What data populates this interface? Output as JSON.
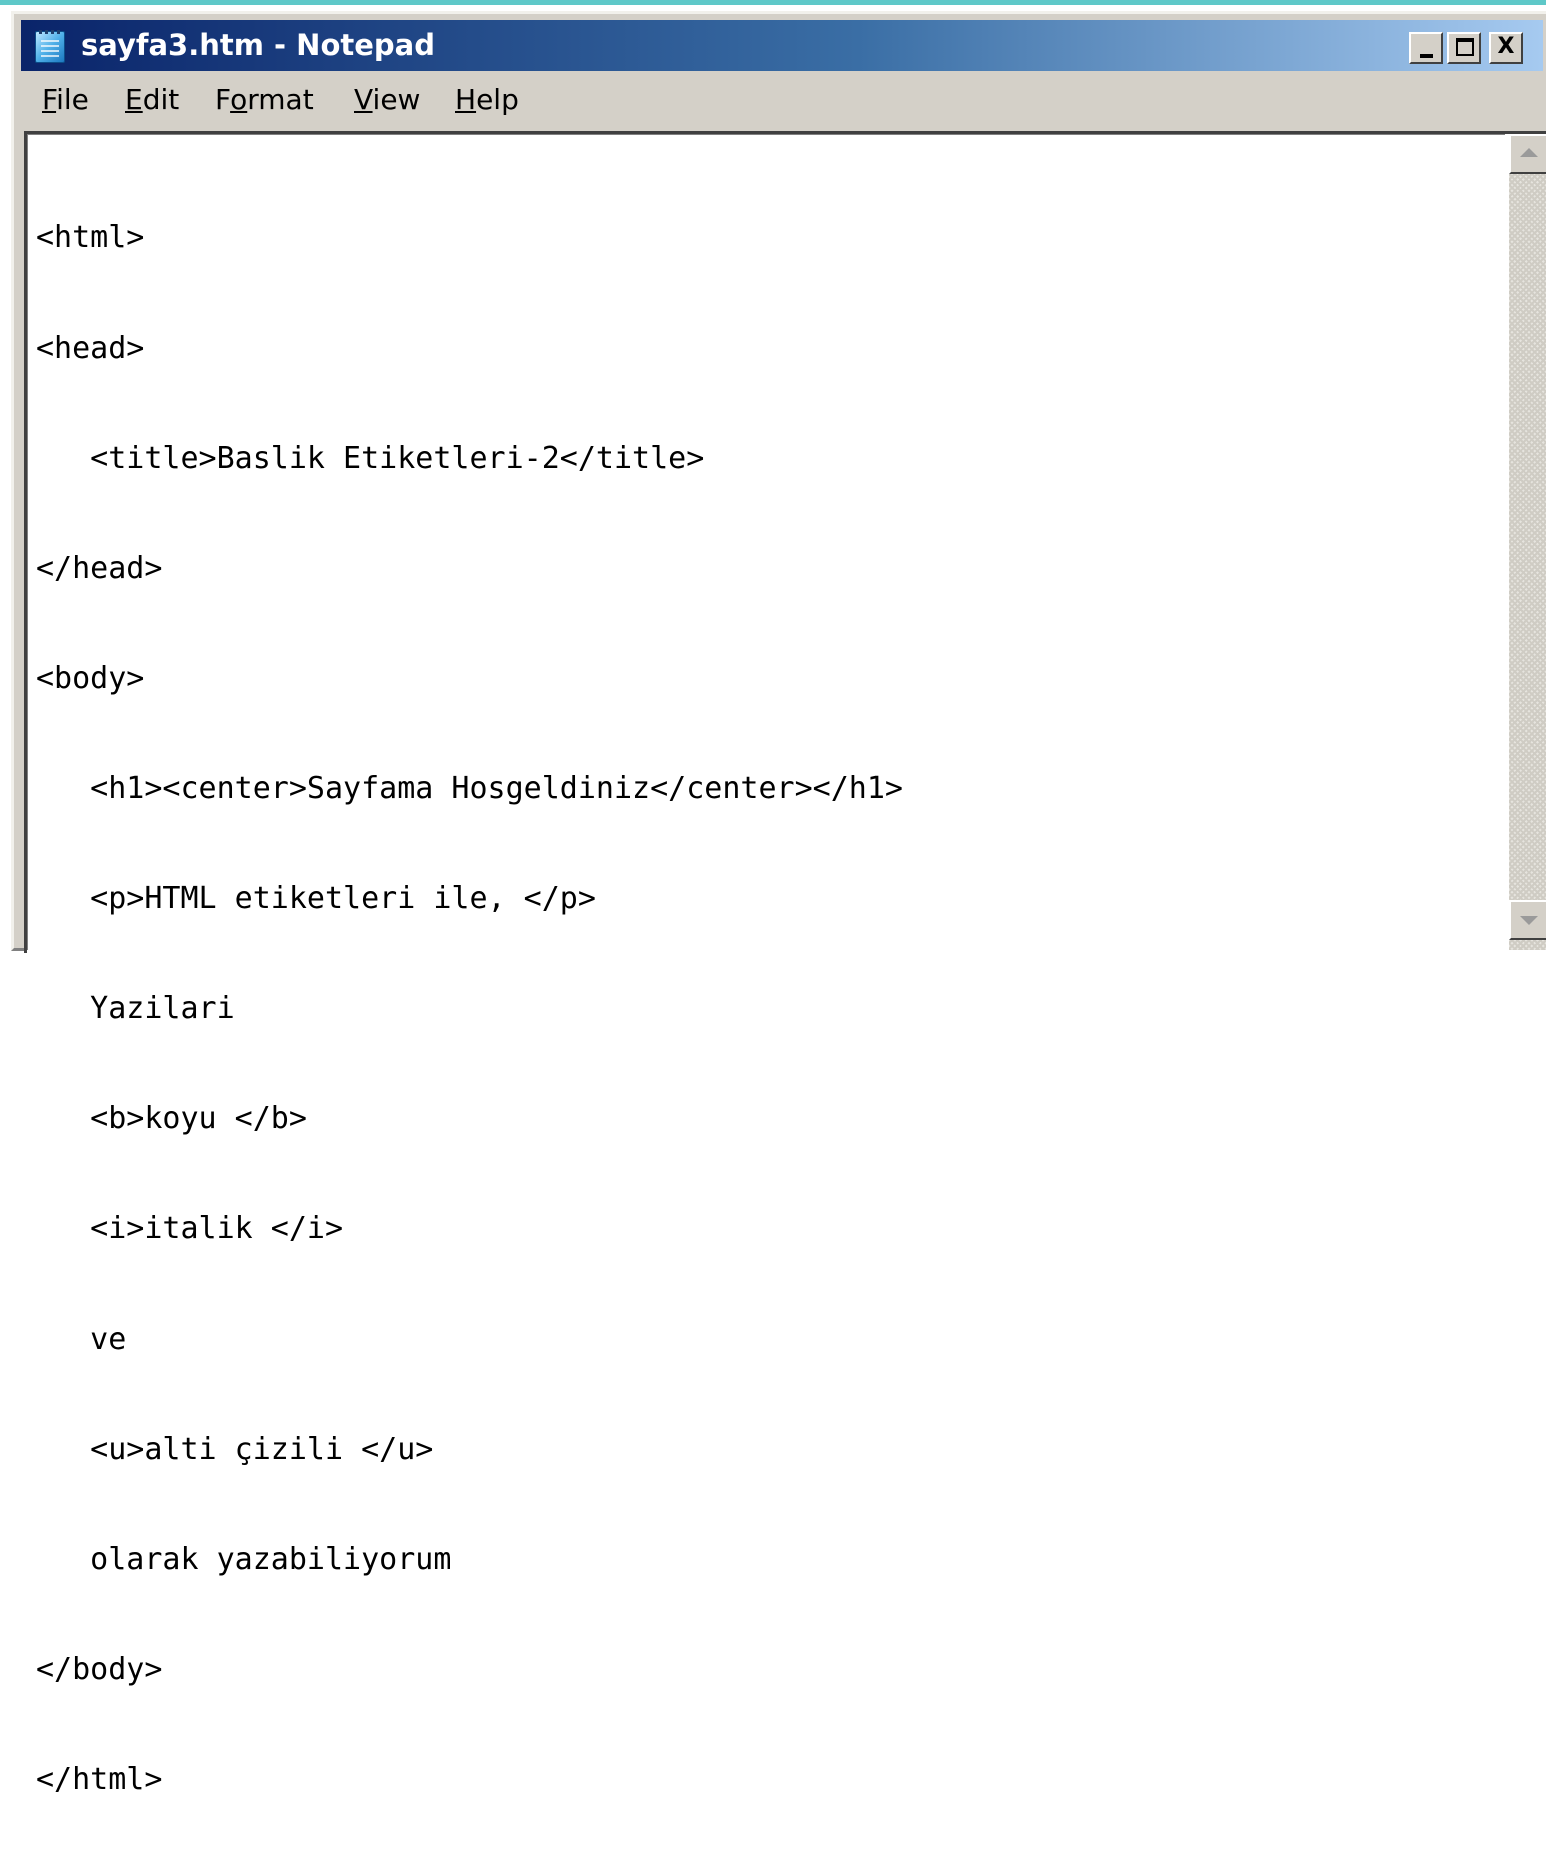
{
  "window": {
    "title": "sayfa3.htm - Notepad",
    "close_glyph": "X",
    "icon": "notepad-icon"
  },
  "menu": {
    "items": [
      {
        "mnemonic": "F",
        "rest": "ile"
      },
      {
        "mnemonic": "E",
        "rest": "dit"
      },
      {
        "pre": "F",
        "mnemonic": "o",
        "rest": "rmat"
      },
      {
        "mnemonic": "V",
        "rest": "iew"
      },
      {
        "mnemonic": "H",
        "rest": "elp"
      }
    ]
  },
  "editor": {
    "lines": [
      "<html>",
      "<head>",
      "   <title>Baslik Etiketleri-2</title>",
      "</head>",
      "<body>",
      "   <h1><center>Sayfama Hosgeldiniz</center></h1>",
      "   <p>HTML etiketleri ile, </p>",
      "   Yazilari",
      "   <b>koyu </b>",
      "   <i>italik </i>",
      "   ve",
      "   <u>alti çizili </u>",
      "   olarak yazabiliyorum",
      "</body>",
      "</html>"
    ]
  },
  "colors": {
    "titlebar_start": "#0a246a",
    "titlebar_end": "#a6caf0",
    "chrome": "#d4d0c8"
  }
}
